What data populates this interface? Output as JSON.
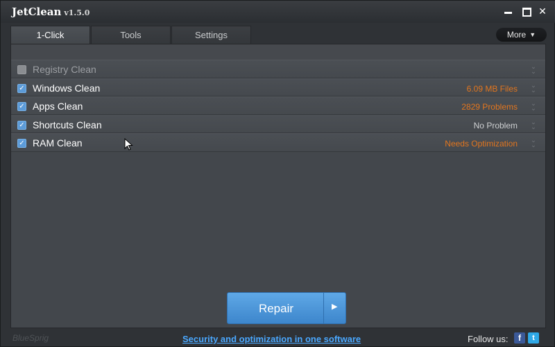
{
  "window": {
    "title": "JetClean",
    "version": "v1.5.0"
  },
  "tabs": [
    {
      "label": "1-Click",
      "active": true
    },
    {
      "label": "Tools",
      "active": false
    },
    {
      "label": "Settings",
      "active": false
    }
  ],
  "more_button": {
    "label": "More"
  },
  "rows": [
    {
      "label": "Registry Clean",
      "checked": false,
      "status": "",
      "status_color": ""
    },
    {
      "label": "Windows Clean",
      "checked": true,
      "status": "6.09 MB  Files",
      "status_color": "#e3761e"
    },
    {
      "label": "Apps Clean",
      "checked": true,
      "status": "2829  Problems",
      "status_color": "#e3761e"
    },
    {
      "label": "Shortcuts Clean",
      "checked": true,
      "status": "No Problem",
      "status_color": "#cfd1d3"
    },
    {
      "label": "RAM Clean",
      "checked": true,
      "status": "Needs Optimization",
      "status_color": "#e3761e"
    }
  ],
  "repair_button": {
    "label": "Repair"
  },
  "footer": {
    "brand": "BlueSprig",
    "tagline": "Security and optimization in one software",
    "follow_label": "Follow us:"
  },
  "colors": {
    "accent": "#4aa8ff",
    "warning": "#e3761e",
    "button": "#4a96da"
  }
}
